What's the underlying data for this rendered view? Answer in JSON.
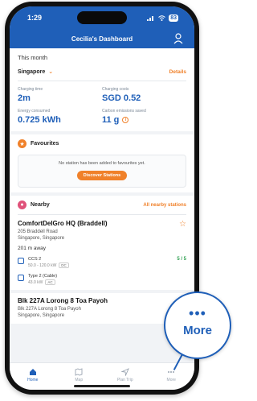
{
  "status_bar": {
    "time": "1:29",
    "battery": "83"
  },
  "app_bar": {
    "title": "Cecilia's Dashboard"
  },
  "this_month": {
    "title": "This month",
    "country": "Singapore",
    "details_link": "Details",
    "stats": [
      {
        "label": "Charging time",
        "value": "2m"
      },
      {
        "label": "Charging costs",
        "value": "SGD 0.52"
      },
      {
        "label": "Energy consumed",
        "value": "0.725 kWh"
      },
      {
        "label": "Carbon emissions saved",
        "value": "11 g"
      }
    ]
  },
  "favourites": {
    "title": "Favourites",
    "empty_message": "No station has been added to favourites yet.",
    "button_label": "Discover Stations"
  },
  "nearby": {
    "title": "Nearby",
    "link": "All nearby stations",
    "station": {
      "name": "ComfortDelGro HQ (Braddell)",
      "address_line1": "205 Braddell Road",
      "address_line2": "Singapore, Singapore",
      "distance": "201 m away",
      "connectors": [
        {
          "name": "CCS 2",
          "spec": "50.0 - 120.0 kW",
          "type": "DC",
          "availability": "5 / 5"
        },
        {
          "name": "Type 2 (Cable)",
          "spec": "43.0 kW",
          "type": "AC",
          "availability": ""
        }
      ]
    },
    "station2": {
      "name": "Blk 227A Lorong 8 Toa Payoh",
      "address_line1": "Blk 227A Lorong 8 Toa Payoh",
      "address_line2": "Singapore, Singapore"
    }
  },
  "tabs": [
    {
      "label": "Home",
      "active": true
    },
    {
      "label": "Map",
      "active": false
    },
    {
      "label": "Plan Trip",
      "active": false
    },
    {
      "label": "More",
      "active": false
    }
  ],
  "callout": {
    "dots": "•••",
    "label": "More"
  },
  "colors": {
    "primary": "#1f5fb8",
    "accent": "#f0812a",
    "success": "#2e9e4f"
  }
}
